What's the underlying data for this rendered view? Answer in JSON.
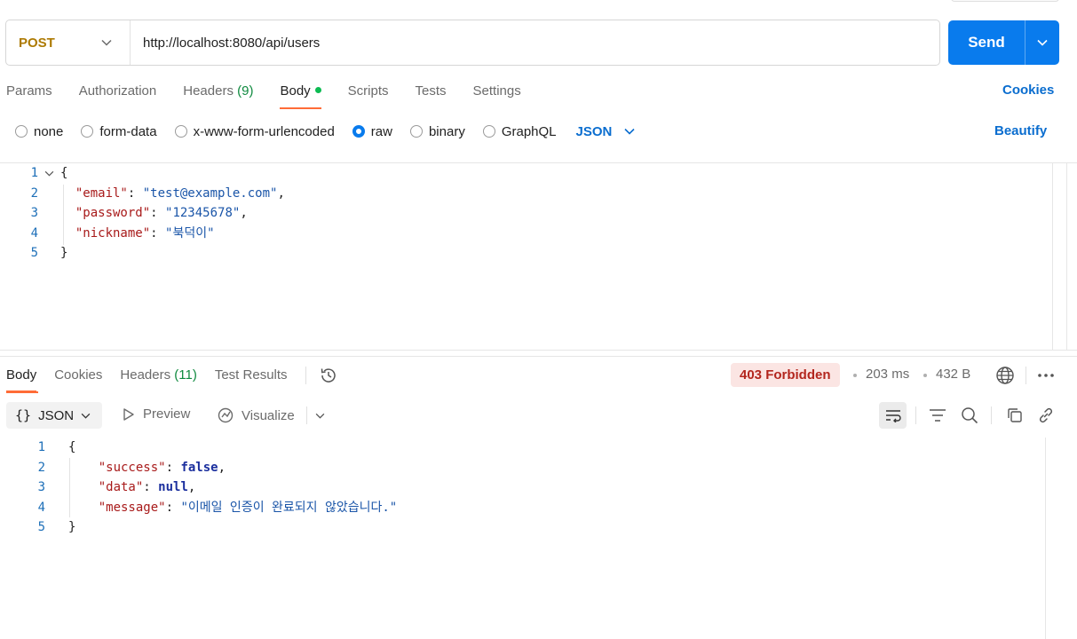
{
  "request": {
    "method": "POST",
    "url": "http://localhost:8080/api/users",
    "send_label": "Send"
  },
  "request_tabs": {
    "params": "Params",
    "authorization": "Authorization",
    "headers": "Headers",
    "headers_count": "(9)",
    "body": "Body",
    "scripts": "Scripts",
    "tests": "Tests",
    "settings": "Settings",
    "cookies": "Cookies"
  },
  "body_options": {
    "none": "none",
    "form_data": "form-data",
    "urlencoded": "x-www-form-urlencoded",
    "raw": "raw",
    "binary": "binary",
    "graphql": "GraphQL",
    "selected_mode": "raw",
    "language": "JSON",
    "beautify": "Beautify"
  },
  "request_body": {
    "line_numbers": [
      "1",
      "2",
      "3",
      "4",
      "5"
    ],
    "open_brace": "{",
    "close_brace": "}",
    "fields": [
      {
        "key": "\"email\"",
        "value": "\"test@example.com\"",
        "comma": ","
      },
      {
        "key": "\"password\"",
        "value": "\"12345678\"",
        "comma": ","
      },
      {
        "key": "\"nickname\"",
        "value": "\"북덕이\"",
        "comma": ""
      }
    ]
  },
  "response_tabs": {
    "body": "Body",
    "cookies": "Cookies",
    "headers": "Headers",
    "headers_count": "(11)",
    "test_results": "Test Results"
  },
  "response_meta": {
    "status": "403 Forbidden",
    "time": "203 ms",
    "size": "432 B"
  },
  "response_toolbar": {
    "format": "JSON",
    "preview": "Preview",
    "visualize": "Visualize"
  },
  "response_body": {
    "line_numbers": [
      "1",
      "2",
      "3",
      "4",
      "5"
    ],
    "open_brace": "{",
    "close_brace": "}",
    "success_key": "\"success\"",
    "success_value": "false",
    "data_key": "\"data\"",
    "data_value": "null",
    "message_key": "\"message\"",
    "message_value": "\"이메일 인증이 완료되지 않았습니다.\""
  },
  "colors": {
    "accent_blue": "#097bed",
    "tab_underline": "#ff6c37",
    "post_method": "#ad7a03",
    "error_badge_bg": "#fbe5e3",
    "error_badge_text": "#b3261e"
  }
}
